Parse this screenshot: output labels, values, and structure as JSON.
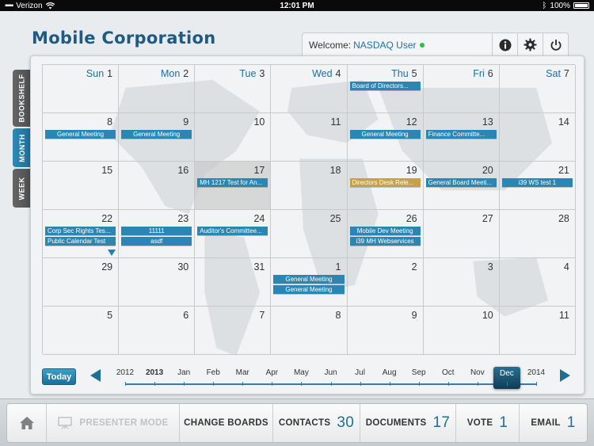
{
  "status_bar": {
    "carrier": "Verizon",
    "time": "12:01 PM",
    "battery": "100%"
  },
  "header": {
    "brand": "Mobile Corporation",
    "welcome_label": "Welcome:",
    "user_name": "NASDAQ User",
    "online_color": "#2fbf3c",
    "icons": [
      "info-icon",
      "gear-icon",
      "power-icon"
    ]
  },
  "side_tabs": [
    {
      "label": "BOOKSHELF",
      "active": false
    },
    {
      "label": "MONTH",
      "active": true
    },
    {
      "label": "WEEK",
      "active": false
    }
  ],
  "calendar": {
    "weeks": [
      [
        {
          "day": "1",
          "dname": "Sun",
          "events": []
        },
        {
          "day": "2",
          "dname": "Mon",
          "events": []
        },
        {
          "day": "3",
          "dname": "Tue",
          "events": []
        },
        {
          "day": "4",
          "dname": "Wed",
          "events": []
        },
        {
          "day": "5",
          "dname": "Thu",
          "events": [
            {
              "title": "Board of Directors...",
              "color": "blue"
            }
          ]
        },
        {
          "day": "6",
          "dname": "Fri",
          "events": []
        },
        {
          "day": "7",
          "dname": "Sat",
          "events": []
        }
      ],
      [
        {
          "day": "8",
          "events": [
            {
              "title": "General Meeting",
              "color": "blue"
            }
          ]
        },
        {
          "day": "9",
          "events": [
            {
              "title": "General Meeting",
              "color": "blue"
            }
          ]
        },
        {
          "day": "10",
          "events": []
        },
        {
          "day": "11",
          "events": []
        },
        {
          "day": "12",
          "events": [
            {
              "title": "General Meeting",
              "color": "blue"
            }
          ]
        },
        {
          "day": "13",
          "events": [
            {
              "title": "Finance Committe...",
              "color": "blue"
            }
          ]
        },
        {
          "day": "14",
          "events": []
        }
      ],
      [
        {
          "day": "15",
          "events": []
        },
        {
          "day": "16",
          "events": []
        },
        {
          "day": "17",
          "today": true,
          "events": [
            {
              "title": "MH 1217 Test for An...",
              "color": "blue"
            }
          ]
        },
        {
          "day": "18",
          "events": []
        },
        {
          "day": "19",
          "events": [
            {
              "title": "Directors Desk Rele...",
              "color": "gold"
            }
          ]
        },
        {
          "day": "20",
          "events": [
            {
              "title": "General Board Meeti...",
              "color": "blue"
            }
          ]
        },
        {
          "day": "21",
          "events": [
            {
              "title": "i39 WS test 1",
              "color": "blue"
            }
          ]
        }
      ],
      [
        {
          "day": "22",
          "more": true,
          "events": [
            {
              "title": "Corp Sec Rights Tes...",
              "color": "blue"
            },
            {
              "title": "Public Calendar Test",
              "color": "blue"
            }
          ]
        },
        {
          "day": "23",
          "events": [
            {
              "title": "11111",
              "color": "blue"
            },
            {
              "title": "asdf",
              "color": "blue"
            }
          ]
        },
        {
          "day": "24",
          "events": [
            {
              "title": "Auditor's Committee...",
              "color": "blue"
            }
          ]
        },
        {
          "day": "25",
          "events": []
        },
        {
          "day": "26",
          "events": [
            {
              "title": "Mobile Dev Meeting",
              "color": "blue"
            },
            {
              "title": "i39 MH Webservices",
              "color": "blue"
            }
          ]
        },
        {
          "day": "27",
          "events": []
        },
        {
          "day": "28",
          "events": []
        }
      ],
      [
        {
          "day": "29",
          "events": []
        },
        {
          "day": "30",
          "events": []
        },
        {
          "day": "31",
          "events": []
        },
        {
          "day": "1",
          "events": [
            {
              "title": "General Meeting",
              "color": "blue"
            },
            {
              "title": "General Meeting",
              "color": "blue"
            }
          ]
        },
        {
          "day": "2",
          "events": []
        },
        {
          "day": "3",
          "events": []
        },
        {
          "day": "4",
          "events": []
        }
      ],
      [
        {
          "day": "5",
          "events": []
        },
        {
          "day": "6",
          "events": []
        },
        {
          "day": "7",
          "events": []
        },
        {
          "day": "8",
          "events": []
        },
        {
          "day": "9",
          "events": []
        },
        {
          "day": "10",
          "events": []
        },
        {
          "day": "11",
          "events": []
        }
      ]
    ]
  },
  "timeline": {
    "today_label": "Today",
    "items": [
      {
        "label": "2012"
      },
      {
        "label": "2013",
        "bold": true
      },
      {
        "label": "Jan"
      },
      {
        "label": "Feb"
      },
      {
        "label": "Mar"
      },
      {
        "label": "Apr"
      },
      {
        "label": "May"
      },
      {
        "label": "Jun"
      },
      {
        "label": "Jul"
      },
      {
        "label": "Aug"
      },
      {
        "label": "Sep"
      },
      {
        "label": "Oct"
      },
      {
        "label": "Nov"
      },
      {
        "label": "Dec",
        "selected": true
      },
      {
        "label": "2014"
      }
    ]
  },
  "toolbar": {
    "presenter_mode": "PRESENTER MODE",
    "change_boards": "CHANGE BOARDS",
    "contacts_label": "CONTACTS",
    "contacts_count": "30",
    "documents_label": "DOCUMENTS",
    "documents_count": "17",
    "vote_label": "VOTE",
    "vote_count": "1",
    "email_label": "EMAIL",
    "email_count": "1"
  },
  "colors": {
    "accent": "#1e6f98",
    "event_blue": "#2b86b3",
    "event_gold": "#c8a04a"
  }
}
